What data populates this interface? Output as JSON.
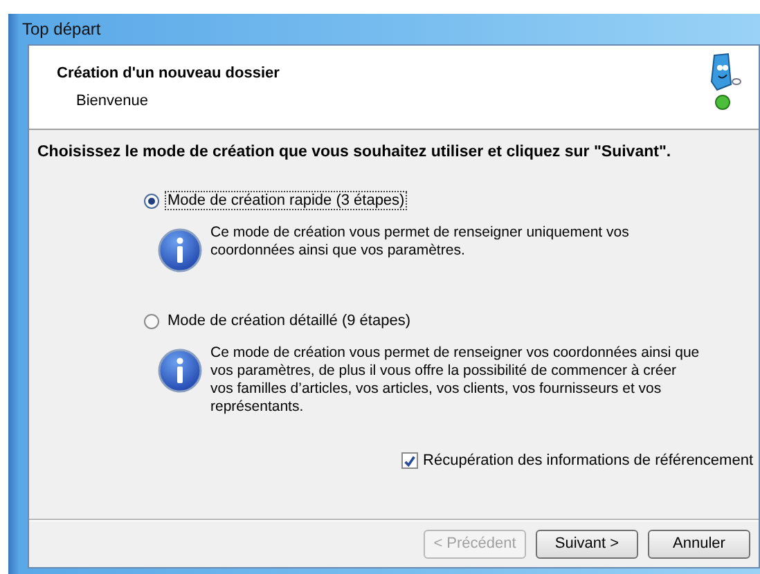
{
  "window": {
    "title": "Top départ"
  },
  "header": {
    "title": "Création d'un nouveau dossier",
    "subtitle": "Bienvenue"
  },
  "instruction": "Choisissez le mode de création que vous souhaitez utiliser et cliquez sur \"Suivant\".",
  "modes": [
    {
      "label": "Mode de création rapide (3 étapes)",
      "selected": true,
      "info": "Ce mode de création vous permet de renseigner uniquement vos coordonnées ainsi que vos paramètres."
    },
    {
      "label": "Mode de création détaillé (9 étapes)",
      "selected": false,
      "info": "Ce mode de création vous permet de renseigner vos coordonnées ainsi que vos paramètres, de plus il vous offre la possibilité de commencer à créer vos familles d’articles, vos articles, vos clients, vos fournisseurs et vos représentants."
    }
  ],
  "option": {
    "label": "Récupération des informations de référencement",
    "checked": true
  },
  "buttons": [
    {
      "label": "< Précédent",
      "disabled": true
    },
    {
      "label": "Suivant >",
      "disabled": false
    },
    {
      "label": "Annuler",
      "disabled": false
    }
  ]
}
